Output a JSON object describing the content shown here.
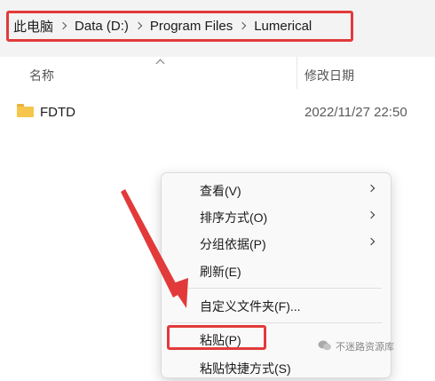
{
  "breadcrumb": {
    "items": [
      "此电脑",
      "Data (D:)",
      "Program Files",
      "Lumerical"
    ]
  },
  "columns": {
    "name": "名称",
    "modified": "修改日期"
  },
  "files": [
    {
      "name": "FDTD",
      "modified": "2022/11/27 22:50",
      "icon": "folder-icon"
    }
  ],
  "context_menu": {
    "items": [
      {
        "label": "查看(V)",
        "submenu": true
      },
      {
        "label": "排序方式(O)",
        "submenu": true
      },
      {
        "label": "分组依据(P)",
        "submenu": true
      },
      {
        "label": "刷新(E)",
        "submenu": false
      },
      {
        "label": "自定义文件夹(F)...",
        "submenu": false
      },
      {
        "label": "粘贴(P)",
        "submenu": false
      },
      {
        "label": "粘贴快捷方式(S)",
        "submenu": false
      }
    ]
  },
  "annotation": {
    "color": "#e23a3a"
  },
  "watermark": "不迷路资源库"
}
